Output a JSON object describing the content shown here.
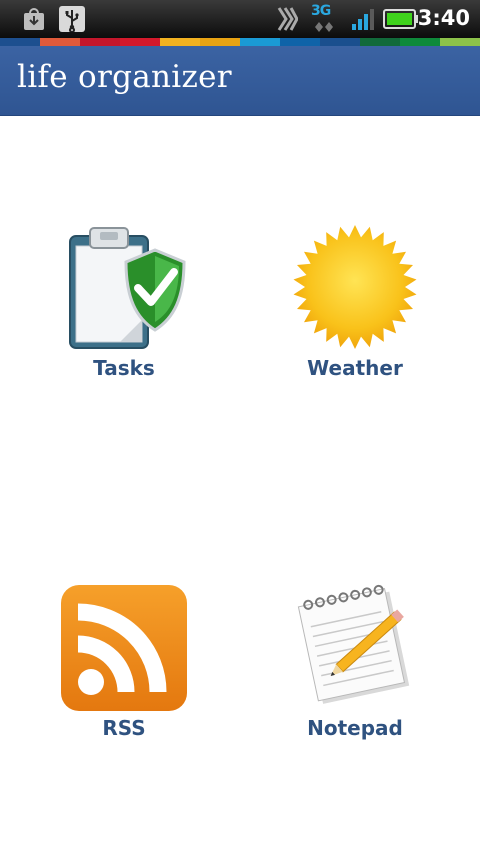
{
  "status_bar": {
    "time": "3:40",
    "network": "3G",
    "icons": [
      "download-icon",
      "usb-icon",
      "sync-icon",
      "signal-icon",
      "battery-icon"
    ]
  },
  "header": {
    "title": "life organizer"
  },
  "grid": {
    "items": [
      {
        "label": "Tasks",
        "icon": "tasks-clipboard-icon"
      },
      {
        "label": "Weather",
        "icon": "sun-icon"
      },
      {
        "label": "RSS",
        "icon": "rss-icon"
      },
      {
        "label": "Notepad",
        "icon": "notepad-icon"
      }
    ]
  },
  "colors": {
    "header_bg": "#3356a0",
    "label": "#2f5280",
    "rainbow": [
      "#1d4f8f",
      "#e05a3a",
      "#c4162b",
      "#d4192b",
      "#f2b221",
      "#e8a313",
      "#1a9ad5",
      "#0f63a8",
      "#1a4f8e",
      "#116a3a",
      "#0e8a3a",
      "#8cc24a"
    ]
  }
}
